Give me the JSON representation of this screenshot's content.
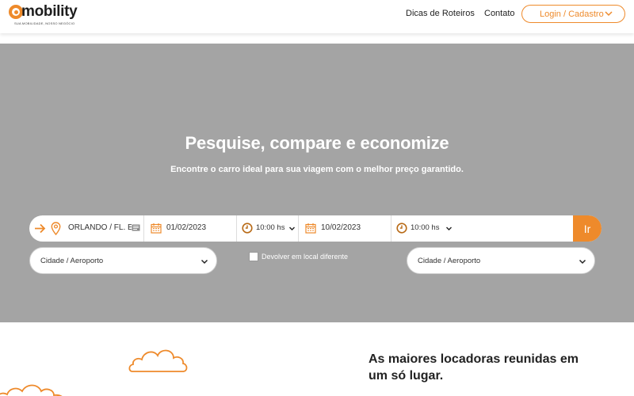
{
  "header": {
    "logo_text": "mobility",
    "logo_tagline": "SUA MOBILIDADE, NOSSO NEGÓCIO",
    "nav": [
      "Dicas de Roteiros",
      "Contato"
    ],
    "login_label": "Login / Cadastro"
  },
  "hero": {
    "title": "Pesquise, compare e economize",
    "subtitle": "Encontre o carro ideal para sua viagem com o melhor preço garantido."
  },
  "search": {
    "location": "ORLANDO / FL. EST",
    "pickup_date": "01/02/2023",
    "pickup_time": "10:00 hs",
    "return_date": "10/02/2023",
    "return_time": "10:00 hs",
    "go_label": "Ir",
    "select_pickup": "Cidade / Aeroporto",
    "select_return": "Cidade / Aeroporto",
    "different_return_label": "Devolver em local diferente"
  },
  "bottom": {
    "heading": "As maiores locadoras reunidas em um só lugar."
  },
  "colors": {
    "accent": "#ee8a2b",
    "hero_bg": "#a4a4a4"
  }
}
